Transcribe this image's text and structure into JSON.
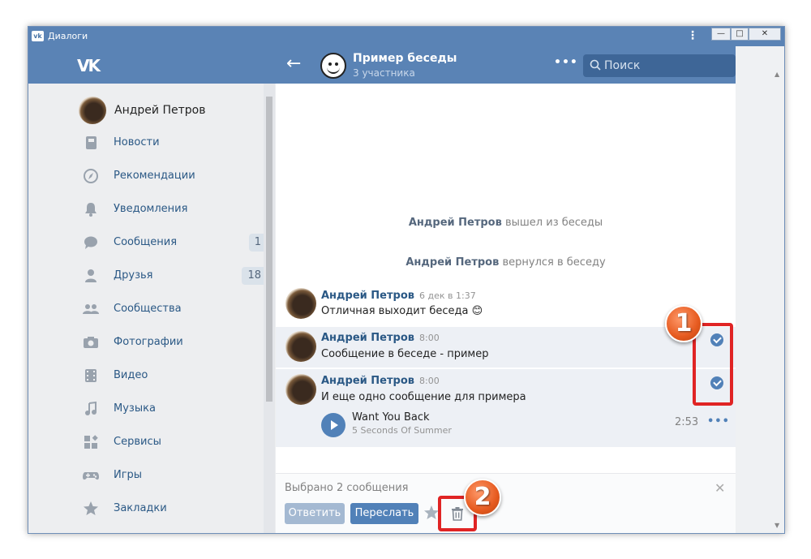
{
  "window": {
    "title": "Диалоги",
    "app_icon": "vk-app-icon",
    "app_icon_text": "vk",
    "kebab": "⋮",
    "controls": [
      "—",
      "□",
      "✕"
    ]
  },
  "header": {
    "logo": "VK",
    "back_icon": "←",
    "chat_title": "Пример беседы",
    "chat_subtitle": "3 участника",
    "more_icon": "•••",
    "search_placeholder": "Поиск"
  },
  "sidebar": {
    "profile_name": "Андрей Петров",
    "items": [
      {
        "label": "Новости",
        "icon": "news-icon"
      },
      {
        "label": "Рекомендации",
        "icon": "compass-icon"
      },
      {
        "label": "Уведомления",
        "icon": "bell-icon"
      },
      {
        "label": "Сообщения",
        "icon": "message-icon",
        "badge": "1"
      },
      {
        "label": "Друзья",
        "icon": "friends-icon",
        "badge": "18"
      },
      {
        "label": "Сообщества",
        "icon": "communities-icon"
      },
      {
        "label": "Фотографии",
        "icon": "camera-icon"
      },
      {
        "label": "Видео",
        "icon": "video-icon"
      },
      {
        "label": "Музыка",
        "icon": "music-icon"
      },
      {
        "label": "Сервисы",
        "icon": "services-icon"
      },
      {
        "label": "Игры",
        "icon": "gamepad-icon"
      },
      {
        "label": "Закладки",
        "icon": "star-icon"
      }
    ]
  },
  "chat": {
    "system_messages": [
      {
        "author": "Андрей Петров",
        "text": "вышел из беседы"
      },
      {
        "author": "Андрей Петров",
        "text": "вернулся в беседу"
      }
    ],
    "messages": [
      {
        "author": "Андрей Петров",
        "time": "6 дек в 1:37",
        "text": "Отличная выходит беседа 😊",
        "selected": false
      },
      {
        "author": "Андрей Петров",
        "time": "8:00",
        "text": "Сообщение в беседе - пример",
        "selected": true
      },
      {
        "author": "Андрей Петров",
        "time": "8:00",
        "text": "И еще одно сообщение для примера",
        "selected": true
      }
    ],
    "audio": {
      "title": "Want You Back",
      "artist": "5 Seconds Of Summer",
      "duration": "2:53",
      "more": "•••"
    },
    "selection_bar": {
      "count_text": "Выбрано 2 сообщения",
      "reply_label": "Ответить",
      "forward_label": "Переслать",
      "close": "✕"
    }
  },
  "annotations": {
    "callout_1": "1",
    "callout_2": "2",
    "color": "#e02424"
  },
  "colors": {
    "header": "#5a83b5",
    "sidebar": "#edeef0",
    "link": "#2a5885",
    "accent": "#5181b8",
    "selected_row": "#edf0f5"
  }
}
